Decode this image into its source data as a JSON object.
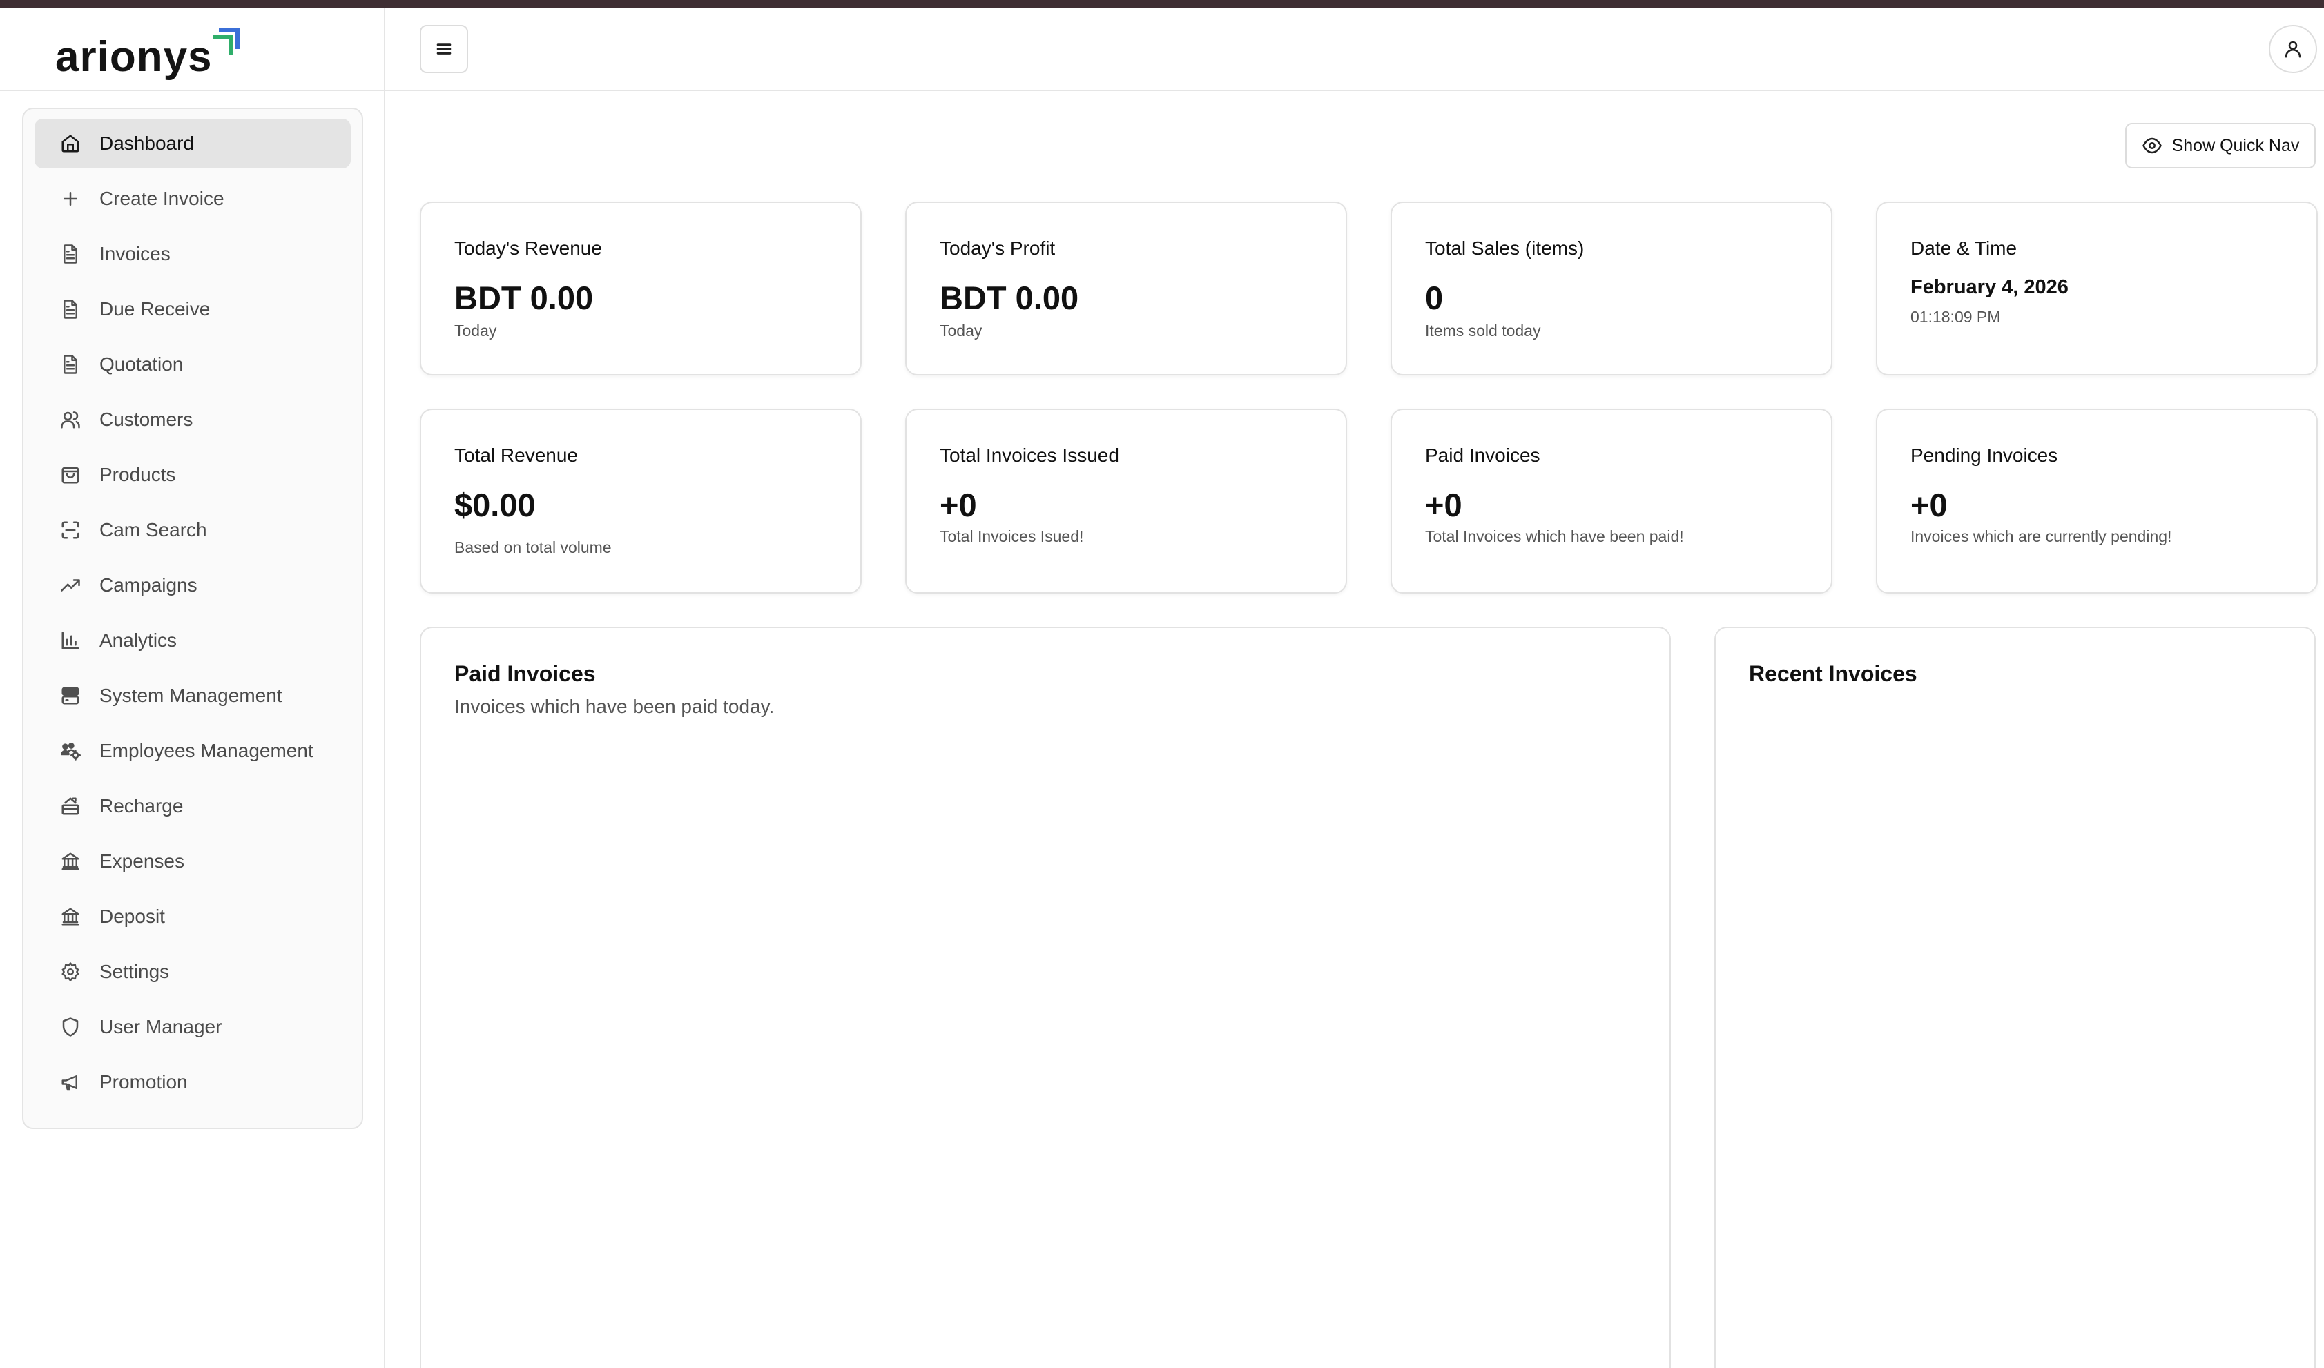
{
  "brand": {
    "name": "arionys",
    "mark_colors": [
      "#2fae6a",
      "#3b6fd8"
    ]
  },
  "header": {
    "menu_icon": "hamburger-menu-icon",
    "user_icon": "user-icon"
  },
  "sidebar": {
    "items": [
      {
        "label": "Dashboard",
        "icon": "home-icon",
        "active": true
      },
      {
        "label": "Create Invoice",
        "icon": "plus-icon"
      },
      {
        "label": "Invoices",
        "icon": "document-icon"
      },
      {
        "label": "Due Receive",
        "icon": "document-icon"
      },
      {
        "label": "Quotation",
        "icon": "document-icon"
      },
      {
        "label": "Customers",
        "icon": "users-icon"
      },
      {
        "label": "Products",
        "icon": "shopping-bag-icon"
      },
      {
        "label": "Cam Search",
        "icon": "scan-icon"
      },
      {
        "label": "Campaigns",
        "icon": "trending-up-icon"
      },
      {
        "label": "Analytics",
        "icon": "bar-chart-icon"
      },
      {
        "label": "System Management",
        "icon": "server-icon"
      },
      {
        "label": "Employees Management",
        "icon": "users-gear-icon"
      },
      {
        "label": "Recharge",
        "icon": "recharge-icon"
      },
      {
        "label": "Expenses",
        "icon": "bank-icon"
      },
      {
        "label": "Deposit",
        "icon": "bank-icon"
      },
      {
        "label": "Settings",
        "icon": "gear-icon"
      },
      {
        "label": "User Manager",
        "icon": "shield-icon"
      },
      {
        "label": "Promotion",
        "icon": "megaphone-icon"
      }
    ]
  },
  "main": {
    "quick_nav_label": "Show Quick Nav",
    "quick_nav_icon": "eye-icon",
    "stats_row1": [
      {
        "title": "Today's Revenue",
        "value": "BDT 0.00",
        "sub": "Today"
      },
      {
        "title": "Today's Profit",
        "value": "BDT 0.00",
        "sub": "Today"
      },
      {
        "title": "Total Sales (items)",
        "value": "0",
        "sub": "Items sold today"
      }
    ],
    "datetime": {
      "title": "Date & Time",
      "date": "February 4, 2026",
      "time": "01:18:09 PM"
    },
    "stats_row2": [
      {
        "title": "Total Revenue",
        "value": "$0.00",
        "sub": "Based on total volume"
      },
      {
        "title": "Total Invoices Issued",
        "value": "+0",
        "sub": "Total Invoices Isued!"
      },
      {
        "title": "Paid Invoices",
        "value": "+0",
        "sub": "Total Invoices which have been paid!"
      },
      {
        "title": "Pending Invoices",
        "value": "+0",
        "sub": "Invoices which are currently pending!"
      }
    ],
    "paid_panel": {
      "title": "Paid Invoices",
      "subtitle": "Invoices which have been paid today."
    },
    "recent_panel": {
      "title": "Recent Invoices"
    }
  }
}
